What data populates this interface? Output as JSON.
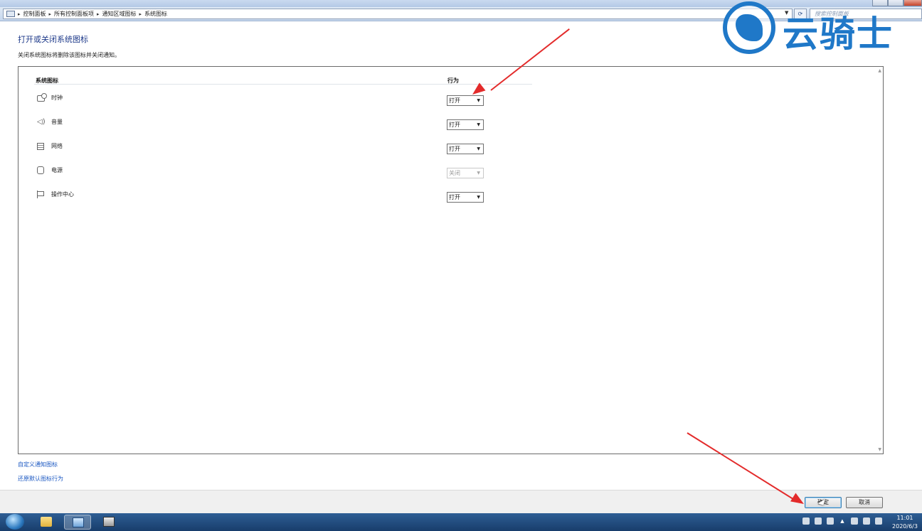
{
  "address_bar": {
    "crumbs": [
      "控制面板",
      "所有控制面板项",
      "通知区域图标",
      "系统图标"
    ],
    "search_placeholder": "搜索控制面板"
  },
  "watermark": {
    "text": "云骑士"
  },
  "page": {
    "title": "打开或关闭系统图标",
    "description": "关闭系统图标将删除该图标并关闭通知。"
  },
  "table": {
    "col_icon": "系统图标",
    "col_behavior": "行为",
    "rows": [
      {
        "icon": "clock-icon",
        "label": "时钟",
        "behavior": "打开",
        "enabled": true
      },
      {
        "icon": "volume-icon",
        "label": "音量",
        "behavior": "打开",
        "enabled": true
      },
      {
        "icon": "network-icon",
        "label": "网络",
        "behavior": "打开",
        "enabled": true
      },
      {
        "icon": "power-icon",
        "label": "电源",
        "behavior": "关闭",
        "enabled": false
      },
      {
        "icon": "action-center-flag-icon",
        "label": "操作中心",
        "behavior": "打开",
        "enabled": true
      }
    ]
  },
  "links": {
    "customize": "自定义通知图标",
    "restore": "还原默认图标行为"
  },
  "buttons": {
    "ok": "确定",
    "cancel": "取消"
  },
  "taskbar": {
    "time": "11:01",
    "date": "2020/6/3"
  },
  "colors": {
    "link": "#1a57c2",
    "title": "#1e3a8a",
    "annotation": "#e32b2b",
    "watermark": "#1f78c8"
  }
}
